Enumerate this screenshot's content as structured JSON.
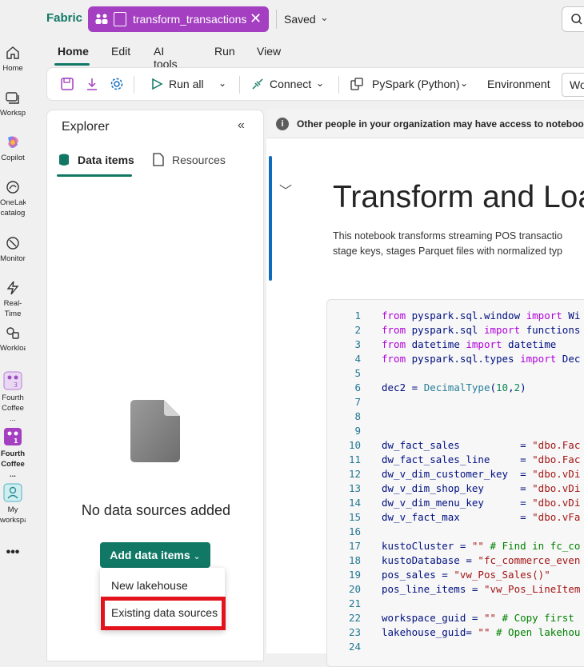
{
  "app": {
    "brand": "Fabric",
    "notebook_tab": "transform_transactions",
    "save_status": "Saved"
  },
  "ribbon": {
    "tabs": [
      "Home",
      "Edit",
      "AI tools",
      "Run",
      "View"
    ]
  },
  "toolbar": {
    "run_all": "Run all",
    "connect": "Connect",
    "language": "PySpark (Python)",
    "environment": "Environment",
    "workspace": "Wo"
  },
  "left_nav": [
    {
      "label": "Home",
      "icon": "home-icon"
    },
    {
      "label": "Workspaces",
      "icon": "workspaces-icon"
    },
    {
      "label": "Copilot",
      "icon": "copilot-icon"
    },
    {
      "label": "OneLake catalog",
      "icon": "onelake-icon"
    },
    {
      "label": "Monitor",
      "icon": "monitor-icon"
    },
    {
      "label": "Real-Time",
      "icon": "realtime-icon"
    },
    {
      "label": "Workloads",
      "icon": "workloads-icon"
    },
    {
      "label": "Fourth Coffee ...",
      "icon": "workspace-icon"
    },
    {
      "label": "Fourth Coffee ...",
      "icon": "workspace-active-icon"
    },
    {
      "label": "My workspace",
      "icon": "my-workspace-icon"
    }
  ],
  "explorer": {
    "title": "Explorer",
    "tabs": {
      "data_items": "Data items",
      "resources": "Resources"
    },
    "empty_message": "No data sources added",
    "add_button": "Add data items",
    "menu": {
      "new_lakehouse": "New lakehouse",
      "existing_sources": "Existing data sources"
    }
  },
  "notebook": {
    "info": "Other people in your organization may have access to notebook",
    "title": "Transform and Loa",
    "para1": "This notebook transforms streaming POS transactio",
    "para2": "stage keys, stages Parquet files with normalized typ",
    "code": [
      {
        "n": "1",
        "parts": [
          [
            "kw",
            "from"
          ],
          [
            "id",
            " pyspark.sql.window "
          ],
          [
            "kw",
            "import"
          ],
          [
            "id",
            " Wi"
          ]
        ]
      },
      {
        "n": "2",
        "parts": [
          [
            "kw",
            "from"
          ],
          [
            "id",
            " pyspark.sql "
          ],
          [
            "kw",
            "import"
          ],
          [
            "id",
            " functions"
          ]
        ]
      },
      {
        "n": "3",
        "parts": [
          [
            "kw",
            "from"
          ],
          [
            "id",
            " datetime "
          ],
          [
            "kw",
            "import"
          ],
          [
            "id",
            " datetime"
          ]
        ]
      },
      {
        "n": "4",
        "parts": [
          [
            "kw",
            "from"
          ],
          [
            "id",
            " pyspark.sql.types "
          ],
          [
            "kw",
            "import"
          ],
          [
            "id",
            " Dec"
          ]
        ]
      },
      {
        "n": "5",
        "parts": []
      },
      {
        "n": "6",
        "parts": [
          [
            "id",
            "dec2 = "
          ],
          [
            "fn",
            "DecimalType"
          ],
          [
            "id",
            "("
          ],
          [
            "num",
            "10"
          ],
          [
            "id",
            ","
          ],
          [
            "num",
            "2"
          ],
          [
            "id",
            ")"
          ]
        ]
      },
      {
        "n": "7",
        "parts": []
      },
      {
        "n": "8",
        "parts": []
      },
      {
        "n": "9",
        "parts": []
      },
      {
        "n": "10",
        "parts": [
          [
            "id",
            "dw_fact_sales          = "
          ],
          [
            "str",
            "\"dbo.Fac"
          ]
        ]
      },
      {
        "n": "11",
        "parts": [
          [
            "id",
            "dw_fact_sales_line     = "
          ],
          [
            "str",
            "\"dbo.Fac"
          ]
        ]
      },
      {
        "n": "12",
        "parts": [
          [
            "id",
            "dw_v_dim_customer_key  = "
          ],
          [
            "str",
            "\"dbo.vDi"
          ]
        ]
      },
      {
        "n": "13",
        "parts": [
          [
            "id",
            "dw_v_dim_shop_key      = "
          ],
          [
            "str",
            "\"dbo.vDi"
          ]
        ]
      },
      {
        "n": "14",
        "parts": [
          [
            "id",
            "dw_v_dim_menu_key      = "
          ],
          [
            "str",
            "\"dbo.vDi"
          ]
        ]
      },
      {
        "n": "15",
        "parts": [
          [
            "id",
            "dw_v_fact_max          = "
          ],
          [
            "str",
            "\"dbo.vFa"
          ]
        ]
      },
      {
        "n": "16",
        "parts": []
      },
      {
        "n": "17",
        "parts": [
          [
            "id",
            "kustoCluster = "
          ],
          [
            "str",
            "\"\""
          ],
          [
            "cm",
            " # Find in fc_co"
          ]
        ]
      },
      {
        "n": "18",
        "parts": [
          [
            "id",
            "kustoDatabase = "
          ],
          [
            "str",
            "\"fc_commerce_even"
          ]
        ]
      },
      {
        "n": "19",
        "parts": [
          [
            "id",
            "pos_sales = "
          ],
          [
            "str",
            "\"vw_Pos_Sales()\""
          ]
        ]
      },
      {
        "n": "20",
        "parts": [
          [
            "id",
            "pos_line_items = "
          ],
          [
            "str",
            "\"vw_Pos_LineItem"
          ]
        ]
      },
      {
        "n": "21",
        "parts": []
      },
      {
        "n": "22",
        "parts": [
          [
            "id",
            "workspace_guid = "
          ],
          [
            "str",
            "\"\""
          ],
          [
            "cm",
            " # Copy first "
          ]
        ]
      },
      {
        "n": "23",
        "parts": [
          [
            "id",
            "lakehouse_guid= "
          ],
          [
            "str",
            "\"\""
          ],
          [
            "cm",
            " # Open lakehou"
          ]
        ]
      },
      {
        "n": "24",
        "parts": []
      }
    ]
  }
}
